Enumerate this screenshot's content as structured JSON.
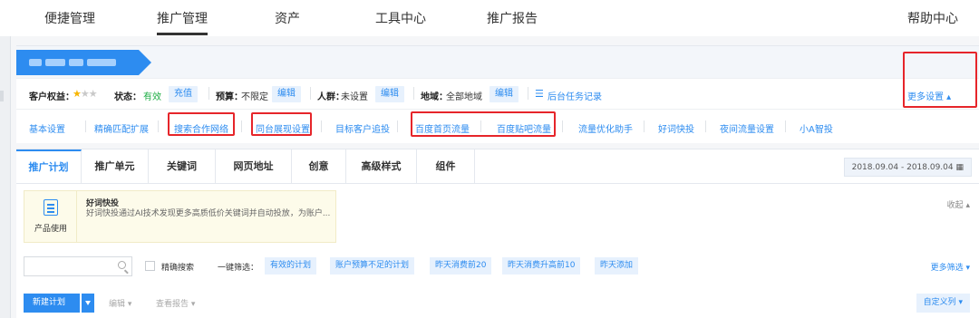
{
  "topnav": {
    "items": [
      "便捷管理",
      "推广管理",
      "资产",
      "工具中心",
      "推广报告"
    ],
    "help": "帮助中心",
    "active_index": 1
  },
  "account": {
    "rights_label": "客户权益：",
    "status_label": "状态：",
    "status_value": "有效",
    "recharge": "充值",
    "budget_label": "预算：",
    "budget_value": "不限定",
    "edit": "编辑",
    "audience_label": "人群：",
    "audience_value": "未设置",
    "region_label": "地域：",
    "region_value": "全部地域",
    "task_log": "后台任务记录",
    "more_settings": "更多设置 ▴",
    "stars_filled": 1,
    "stars_total": 3
  },
  "sublinks": [
    "基本设置",
    "精确匹配扩展",
    "搜索合作网络",
    "同台展现设置",
    "目标客户追投",
    "百度首页流量",
    "百度贴吧流量",
    "流量优化助手",
    "好词快投",
    "夜间流量设置",
    "小A智投"
  ],
  "tabs": [
    "推广计划",
    "推广单元",
    "关键词",
    "网页地址",
    "创意",
    "高级样式",
    "组件"
  ],
  "date_range": "2018.09.04 - 2018.09.04 ▦",
  "promo": {
    "icon_label": "产品使用",
    "title": "好词快投",
    "desc": "好词快投通过AI技术发现更多高质低价关键词并自动投放，为账户..."
  },
  "collapse": "收起 ▴",
  "filter": {
    "search_placeholder": "",
    "exact_search": "精确搜索",
    "quick_label": "一键筛选：",
    "chips": [
      "有效的计划",
      "账户预算不足的计划",
      "昨天消费前20",
      "昨天消费升高前10",
      "昨天添加"
    ],
    "more": "更多筛选 ▾"
  },
  "actions": {
    "new_plan": "新建计划",
    "edit": "编辑 ▾",
    "view_report": "查看报告 ▾",
    "custom_columns": "自定义列 ▾"
  },
  "colors": {
    "accent": "#2d8cf0",
    "highlight": "#e6252a",
    "ok": "#1cad43"
  }
}
